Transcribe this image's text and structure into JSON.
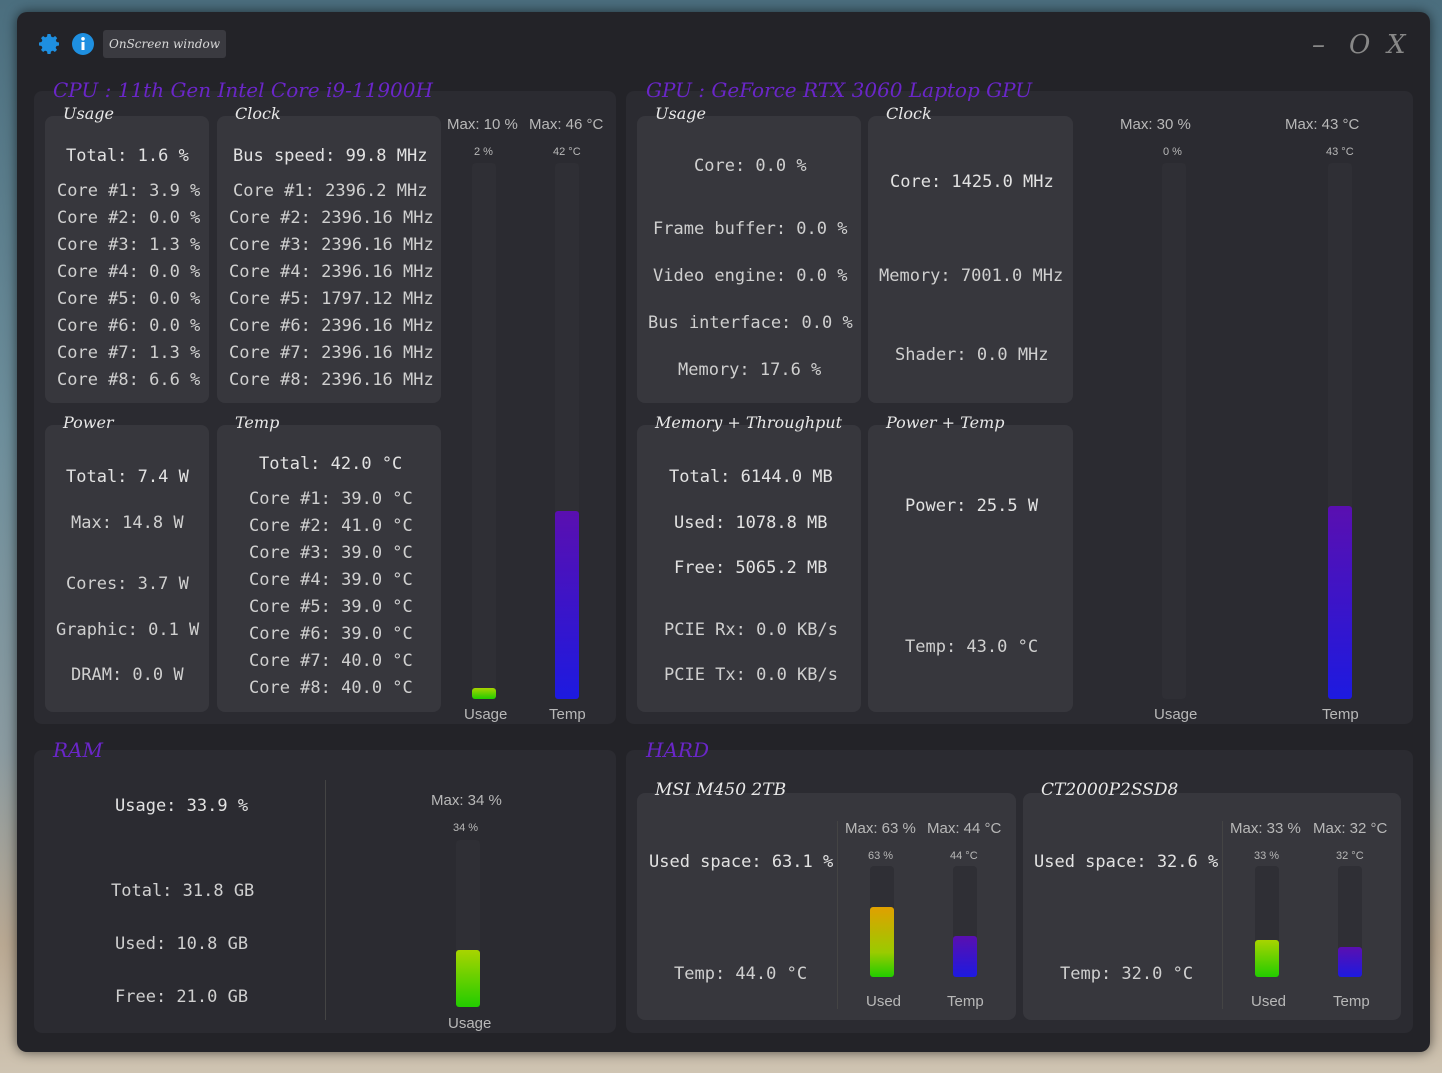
{
  "window": {
    "label": "OnScreen window",
    "minimize": "–",
    "maximize": "O",
    "close": "X",
    "accent": "#6a26c8"
  },
  "cpu": {
    "title": "CPU :   11th Gen Intel Core i9-11900H",
    "usage": {
      "title": "Usage",
      "total": "Total: 1.6 %",
      "cores": [
        "Core #1: 3.9 %",
        "Core #2: 0.0 %",
        "Core #3: 1.3 %",
        "Core #4: 0.0 %",
        "Core #5: 0.0 %",
        "Core #6: 0.0 %",
        "Core #7: 1.3 %",
        "Core #8: 6.6 %"
      ]
    },
    "clock": {
      "title": "Clock",
      "bus": "Bus speed: 99.8 MHz",
      "cores": [
        "Core #1: 2396.2 MHz",
        "Core #2: 2396.16 MHz",
        "Core #3: 2396.16 MHz",
        "Core #4: 2396.16 MHz",
        "Core #5: 1797.12 MHz",
        "Core #6: 2396.16 MHz",
        "Core #7: 2396.16 MHz",
        "Core #8: 2396.16 MHz"
      ]
    },
    "power": {
      "title": "Power",
      "total": "Total: 7.4 W",
      "max": "Max: 14.8 W",
      "cores": "Cores: 3.7 W",
      "graphic": "Graphic: 0.1 W",
      "dram": "DRAM: 0.0 W"
    },
    "temp": {
      "title": "Temp",
      "total": "Total: 42.0 °C",
      "cores": [
        "Core #1: 39.0 °C",
        "Core #2: 41.0 °C",
        "Core #3: 39.0 °C",
        "Core #4: 39.0 °C",
        "Core #5: 39.0 °C",
        "Core #6: 39.0 °C",
        "Core #7: 40.0 °C",
        "Core #8: 40.0 °C"
      ]
    },
    "gauges": {
      "max_usage": "Max: 10 %",
      "max_temp": "Max: 46 °C",
      "usage_value": "2 %",
      "temp_value": "42 °C",
      "usage_label": "Usage",
      "temp_label": "Temp",
      "usage_level": 0.02,
      "temp_level": 0.35
    }
  },
  "gpu": {
    "title": "GPU :    GeForce RTX 3060 Laptop GPU",
    "usage": {
      "title": "Usage",
      "core": "Core: 0.0 %",
      "frame_buffer": "Frame buffer: 0.0 %",
      "video_engine": "Video engine: 0.0 %",
      "bus_interface": "Bus interface: 0.0 %",
      "memory": "Memory: 17.6 %"
    },
    "clock": {
      "title": "Clock",
      "core": "Core: 1425.0 MHz",
      "memory": "Memory: 7001.0 MHz",
      "shader": "Shader: 0.0 MHz"
    },
    "memory": {
      "title": "Memory + Throughput",
      "total": "Total: 6144.0 MB",
      "used": "Used: 1078.8 MB",
      "free": "Free: 5065.2 MB",
      "pcie_rx": "PCIE Rx: 0.0 KB/s",
      "pcie_tx": "PCIE Tx: 0.0 KB/s"
    },
    "power_temp": {
      "title": "Power + Temp",
      "power": "Power: 25.5 W",
      "temp": "Temp: 43.0 °C"
    },
    "gauges": {
      "max_usage": "Max: 30 %",
      "max_temp": "Max: 43 °C",
      "usage_value": "0 %",
      "temp_value": "43 °C",
      "usage_label": "Usage",
      "temp_label": "Temp",
      "usage_level": 0.0,
      "temp_level": 0.36
    }
  },
  "ram": {
    "title": "RAM",
    "usage": "Usage: 33.9 %",
    "total": "Total: 31.8 GB",
    "used": "Used: 10.8 GB",
    "free": "Free: 21.0 GB",
    "gauge": {
      "max": "Max: 34 %",
      "value": "34 %",
      "label": "Usage",
      "level": 0.34
    }
  },
  "hard": {
    "title": "HARD",
    "disks": [
      {
        "name": "MSI M450 2TB",
        "used_space": "Used space: 63.1 %",
        "temp": "Temp: 44.0 °C",
        "max_used": "Max: 63 %",
        "max_temp": "Max: 44 °C",
        "used_value": "63 %",
        "temp_value": "44 °C",
        "used_label": "Used",
        "temp_label": "Temp",
        "used_level": 0.63,
        "temp_level": 0.37
      },
      {
        "name": "CT2000P2SSD8",
        "used_space": "Used space: 32.6 %",
        "temp": "Temp: 32.0 °C",
        "max_used": "Max: 33 %",
        "max_temp": "Max: 32 °C",
        "used_value": "33 %",
        "temp_value": "32 °C",
        "used_label": "Used",
        "temp_label": "Temp",
        "used_level": 0.33,
        "temp_level": 0.27
      }
    ]
  }
}
